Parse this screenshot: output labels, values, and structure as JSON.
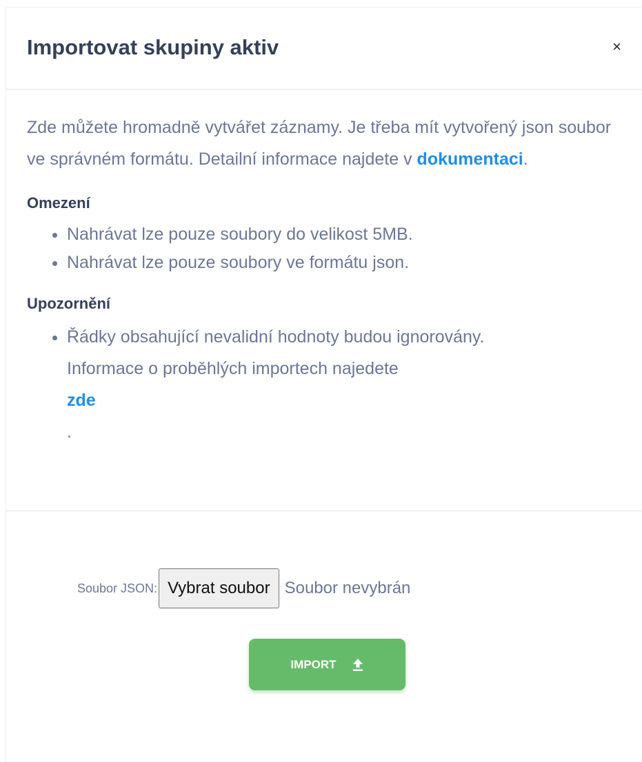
{
  "modal": {
    "title": "Importovat skupiny aktiv",
    "close_label": "×"
  },
  "intro": {
    "text_before": "Zde můžete hromadně vytvářet záznamy. Je třeba mít vytvořený json soubor ve správném formátu. Detailní informace najdete v ",
    "link_text": "dokumentaci",
    "text_after": "."
  },
  "limits": {
    "heading": "Omezení",
    "items": [
      "Nahrávat lze pouze soubory do velikost 5MB.",
      "Nahrávat lze pouze soubory ve formátu json."
    ]
  },
  "warning": {
    "heading": "Upozornění",
    "line1": "Řádky obsahující nevalidní hodnoty budou ignorovány.",
    "line2_before": "Informace o proběhlých importech najedete ",
    "link_text": "zde",
    "line2_after": "."
  },
  "form": {
    "file_label": "Soubor JSON:",
    "file_button": "Vybrat soubor",
    "file_status": "Soubor nevybrán",
    "import_label": "IMPORT",
    "import_icon": "upload-icon"
  },
  "colors": {
    "title": "#34405a",
    "body_text": "#6b7795",
    "link": "#1e8ee9",
    "import_button": "#66bb6a"
  }
}
